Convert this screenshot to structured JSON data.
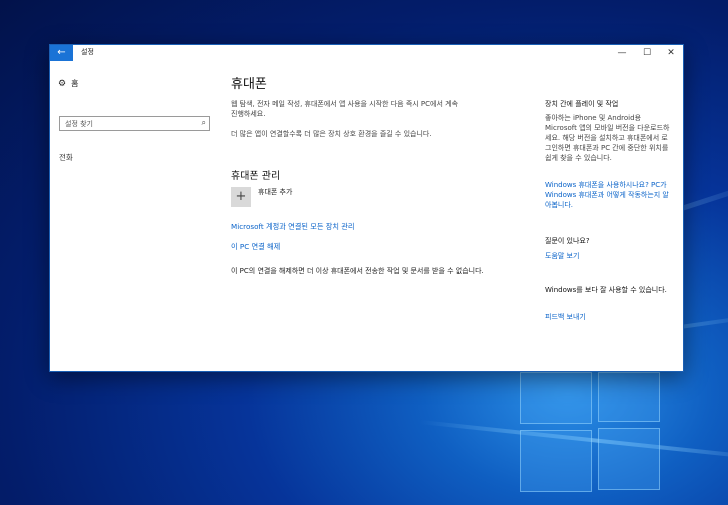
{
  "colors": {
    "accent": "#1a73d6",
    "link": "#0a63c9"
  },
  "window": {
    "title": "설정",
    "back_icon": "back-arrow-icon",
    "minimize": "—",
    "maximize": "☐",
    "close": "✕"
  },
  "sidebar": {
    "home_icon": "⚙",
    "home_label": "홈",
    "search_placeholder": "설정 찾기",
    "search_icon": "⌕",
    "items": [
      {
        "label": "전화"
      }
    ]
  },
  "main": {
    "title": "휴대폰",
    "desc1": "웹 탐색, 전자 메일 작성, 휴대폰에서 앱 사용을 시작한 다음 즉시 PC에서 계속 진행하세요.",
    "desc2": "더 많은 앱이 연결할수록 더 많은 장치 상호 환경을 즐길 수 있습니다.",
    "section_title": "휴대폰 관리",
    "add_icon": "+",
    "add_label": "휴대폰 추가",
    "manage_link": "Microsoft 계정과 연결된 모든 장치 관리",
    "unlink_link": "이 PC 연결 해제",
    "unlink_desc": "이 PC의 연결을 해제하면 더 이상 휴대폰에서 전송한 작업 및 문서를 받을 수 없습니다."
  },
  "right": {
    "heading": "장치 간에 플레이 및 작업",
    "desc": "좋아하는 iPhone 및 Android용 Microsoft 앱의 모바일 버전을 다운로드하세요. 해당 버전을 설치하고 휴대폰에서 로그인하면 휴대폰과 PC 간에 중단한 위치를 쉽게 찾을 수 있습니다.",
    "link": "Windows 휴대폰을 사용하시나요? PC가 Windows 휴대폰과 어떻게 작동하는지 알아봅니다.",
    "question": "질문이 있나요?",
    "help_link": "도움말 보기",
    "improve": "Windows를 보다 잘 사용할 수 있습니다.",
    "feedback_link": "피드백 보내기"
  }
}
